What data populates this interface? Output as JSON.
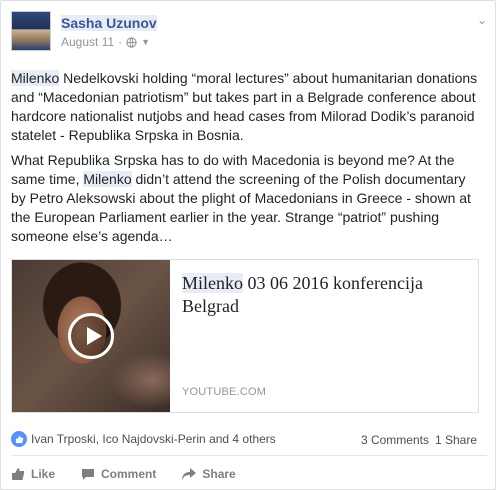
{
  "post": {
    "author": "Sasha Uzunov",
    "date": "August 11",
    "separator": "·",
    "paragraph1": {
      "highlight": "Milenko",
      "rest": " Nedelkovski holding “moral lectures” about humanitarian donations and “Macedonian patriotism” but takes part in a Belgrade conference about hardcore nationalist nutjobs and head cases from Milorad Dodik’s paranoid statelet - Republika Srpska in Bosnia."
    },
    "paragraph2": {
      "before": "What Republika Srpska has to do with Macedonia is beyond me? At the same time, ",
      "highlight": "Milenko",
      "after": " didn’t attend the screening of the Polish documentary by Petro Aleksowski about the plight of Macedonians in Greece - shown at the European Parliament earlier in the year. Strange “patriot” pushing someone else’s agenda…"
    }
  },
  "link_preview": {
    "title_highlight": "Milenko",
    "title_rest": " 03 06 2016 konferencija Belgrad",
    "domain": "YOUTUBE.COM"
  },
  "social": {
    "likers": "Ivan Trposki, Ico Najdovski-Perin and 4 others",
    "comments": "3 Comments",
    "shares": "1 Share"
  },
  "actions": {
    "like": "Like",
    "comment": "Comment",
    "share": "Share"
  },
  "colors": {
    "link_blue": "#365899",
    "highlight_bg": "#e8ecf4",
    "like_badge": "#5890ff"
  },
  "icons": {
    "globe": "globe-icon",
    "caret": "caret-down-icon",
    "chevron": "chevron-down-icon",
    "play": "play-icon",
    "like": "thumbs-up-icon",
    "comment": "comment-bubble-icon",
    "share": "share-arrow-icon"
  }
}
